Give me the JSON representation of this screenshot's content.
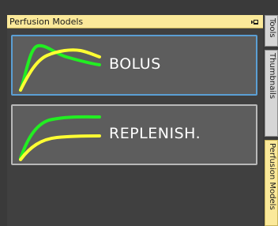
{
  "panel": {
    "title": "Perfusion Models",
    "pin_icon": "pin-icon"
  },
  "models": [
    {
      "label": "BOLUS",
      "selected": true,
      "curve_icon": "bolus-curve-icon"
    },
    {
      "label": "REPLENISH.",
      "selected": false,
      "curve_icon": "replenish-curve-icon"
    }
  ],
  "side_tabs": [
    {
      "label": "Tools",
      "active": false
    },
    {
      "label": "Thumbnails",
      "active": false
    },
    {
      "label": "Perfusion Models",
      "active": true
    }
  ],
  "colors": {
    "header_bg": "#fbe99a",
    "selected_border": "#5b9fd4",
    "card_bg": "#5d5d5d",
    "curve_green": "#22ee22",
    "curve_yellow": "#ffff33"
  }
}
